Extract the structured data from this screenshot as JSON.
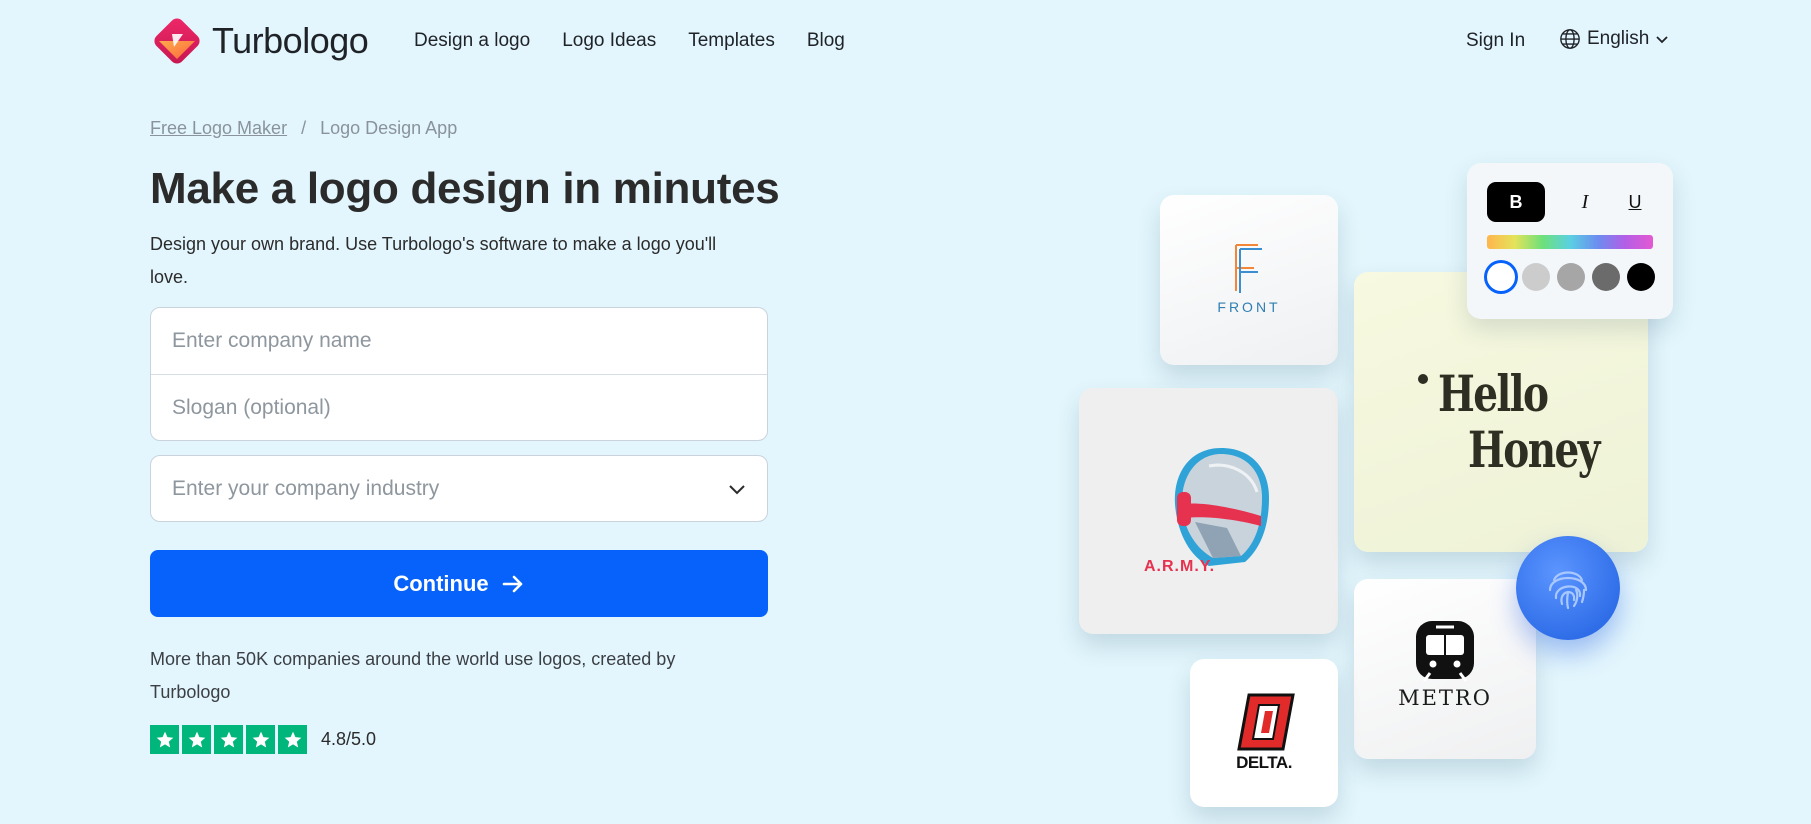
{
  "header": {
    "brand": "Turbologo",
    "nav": [
      "Design a logo",
      "Logo Ideas",
      "Templates",
      "Blog"
    ],
    "sign_in": "Sign In",
    "language": "English"
  },
  "breadcrumb": {
    "link": "Free Logo Maker",
    "separator": "/",
    "current": "Logo Design App"
  },
  "hero": {
    "title": "Make a logo design in minutes",
    "subtitle": "Design your own brand. Use Turbologo's software to make a logo you'll love."
  },
  "form": {
    "company_name": {
      "value": "",
      "placeholder": "Enter company name"
    },
    "slogan": {
      "value": "",
      "placeholder": "Slogan (optional)"
    },
    "industry": {
      "value": "",
      "placeholder": "Enter your company industry"
    },
    "continue_label": "Continue"
  },
  "social_proof": {
    "text": "More than 50K companies around the world use logos, created by Turbologo",
    "rating": "4.8/5.0",
    "stars": 5
  },
  "showcase": {
    "front": {
      "letter": "F",
      "label": "FRONT"
    },
    "army": {
      "label": "A.R.M.Y."
    },
    "honey": {
      "line1": "Hello",
      "line2": "Honey"
    },
    "metro": {
      "label": "METRO"
    },
    "delta": {
      "label": "DELTA."
    },
    "format_panel": {
      "bold": "B",
      "italic": "I",
      "underline": "U",
      "swatches": [
        "#ffffff",
        "#cccccc",
        "#a6a6a6",
        "#6b6b6b",
        "#000000"
      ],
      "selected_swatch": 0
    }
  },
  "colors": {
    "background": "#e3f6fd",
    "primary": "#0662fb",
    "trustpilot": "#00b67a"
  }
}
